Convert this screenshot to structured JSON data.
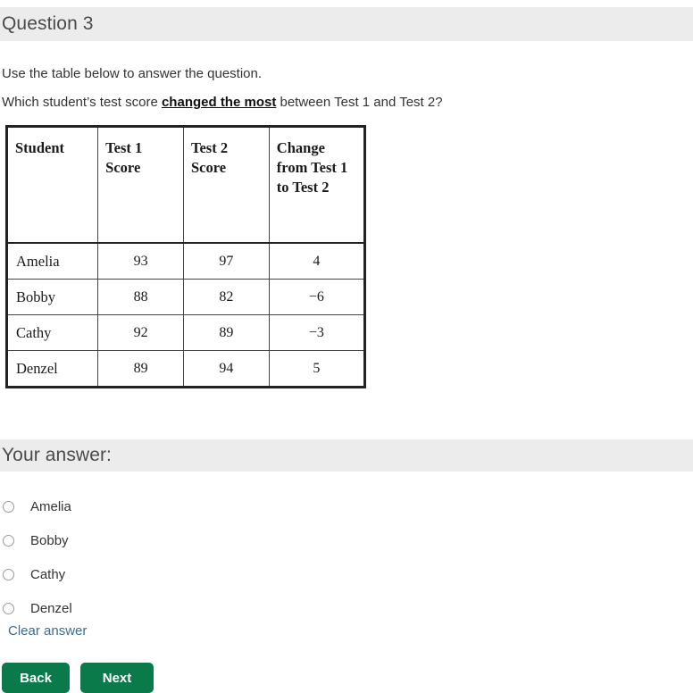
{
  "question_header": {
    "title": "Question 3"
  },
  "prompt": {
    "line1": "Use the table below to answer the question.",
    "line2_before": "Which student’s test score ",
    "line2_emphasis": "changed the most",
    "line2_after": " between Test 1 and Test 2?"
  },
  "table": {
    "headers": {
      "student": "Student",
      "test1": "Test 1 Score",
      "test2": "Test 2 Score",
      "change": "Change from Test 1 to Test 2"
    },
    "rows": [
      {
        "student": "Amelia",
        "test1": "93",
        "test2": "97",
        "change": "4"
      },
      {
        "student": "Bobby",
        "test1": "88",
        "test2": "82",
        "change": "−6"
      },
      {
        "student": "Cathy",
        "test1": "92",
        "test2": "89",
        "change": "−3"
      },
      {
        "student": "Denzel",
        "test1": "89",
        "test2": "94",
        "change": "5"
      }
    ]
  },
  "answer_header": {
    "title": "Your answer:"
  },
  "answer_options": [
    {
      "label": "Amelia",
      "selected": false
    },
    {
      "label": "Bobby",
      "selected": false
    },
    {
      "label": "Cathy",
      "selected": false
    },
    {
      "label": "Denzel",
      "selected": false
    }
  ],
  "clear_answer": {
    "label": "Clear answer"
  },
  "navigation": {
    "back_label": "Back",
    "next_label": "Next"
  },
  "colors": {
    "banner_background": "#ececec",
    "button_green": "#0b7a4b",
    "link_blue": "#3d6c8e",
    "text": "#333333",
    "table_border": "#222222"
  }
}
